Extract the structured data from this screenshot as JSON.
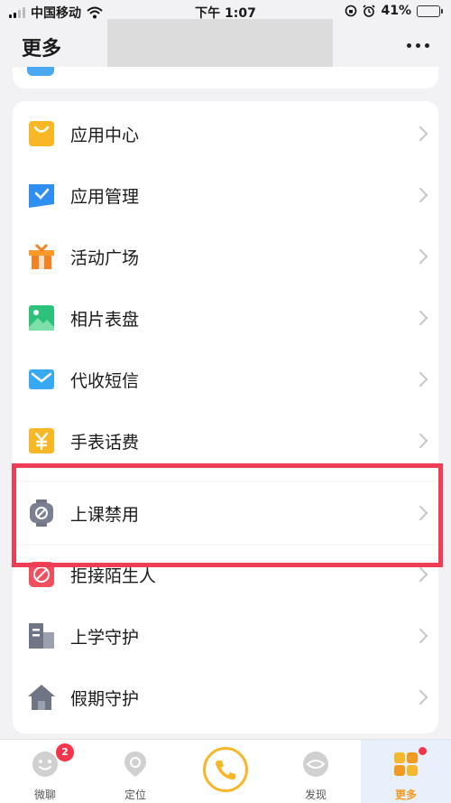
{
  "status_bar": {
    "carrier": "中国移动",
    "time": "下午 1:07",
    "battery_percent": "41%",
    "battery_level": 0.41
  },
  "header": {
    "title": "更多"
  },
  "menu": {
    "items": [
      {
        "label": "应用中心",
        "icon": "app-center-icon"
      },
      {
        "label": "应用管理",
        "icon": "app-manage-icon"
      },
      {
        "label": "活动广场",
        "icon": "gift-icon"
      },
      {
        "label": "相片表盘",
        "icon": "photo-icon"
      },
      {
        "label": "代收短信",
        "icon": "mail-icon"
      },
      {
        "label": "手表话费",
        "icon": "yuan-icon"
      },
      {
        "label": "上课禁用",
        "icon": "watch-disable-icon"
      },
      {
        "label": "拒接陌生人",
        "icon": "reject-call-icon"
      },
      {
        "label": "上学守护",
        "icon": "school-building-icon"
      },
      {
        "label": "假期守护",
        "icon": "home-icon"
      }
    ]
  },
  "bottom_nav": {
    "items": [
      {
        "label": "微聊",
        "badge": "2"
      },
      {
        "label": "定位"
      },
      {
        "label": ""
      },
      {
        "label": "发现"
      },
      {
        "label": "更多"
      }
    ]
  },
  "colors": {
    "accent": "#f29a1f",
    "highlight_frame": "#ee3d55",
    "badge": "#f4344c"
  }
}
